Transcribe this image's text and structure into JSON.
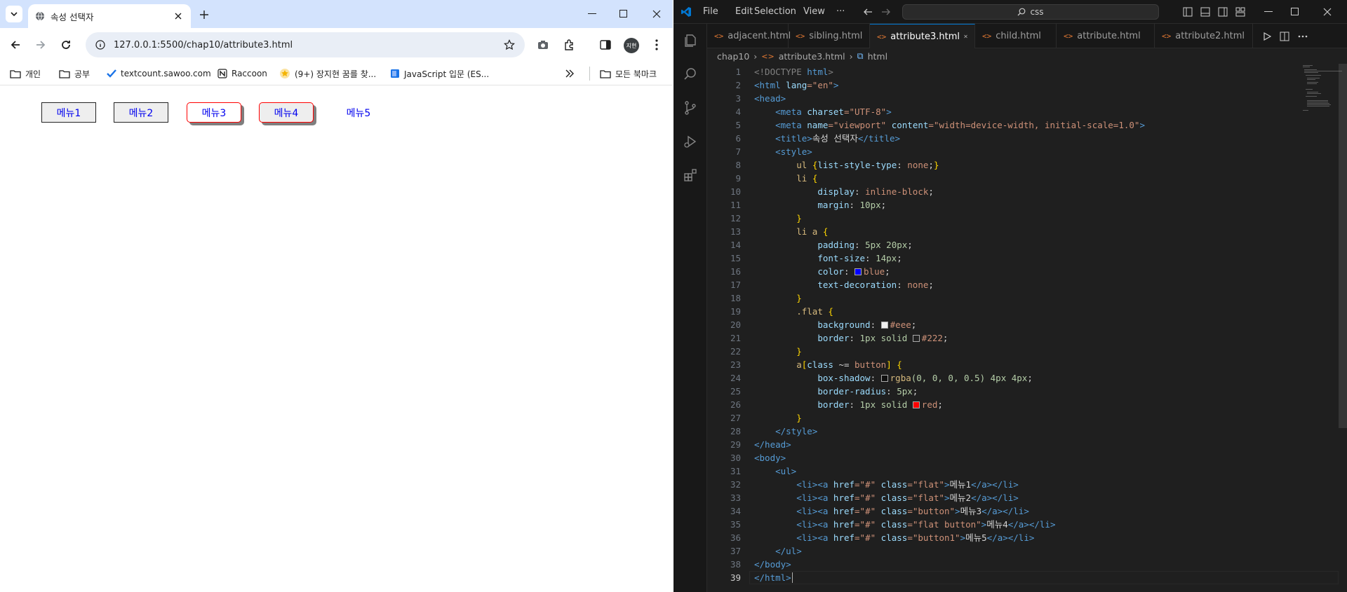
{
  "browser": {
    "tab_title": "속성 선택자",
    "url": "127.0.0.1:5500/chap10/attribute3.html",
    "avatar_text": "지현",
    "bookmarks": [
      "개인",
      "공부",
      "textcount.sawoo.com",
      "Raccoon",
      "(9+) 장지현 꿈를 찾...",
      "JavaScript 입문 (ES...",
      "모든 북마크"
    ],
    "page_menu": [
      "메뉴1",
      "메뉴2",
      "메뉴3",
      "메뉴4",
      "메뉴5"
    ]
  },
  "vscode": {
    "menu": [
      "File",
      "Edit",
      "Selection",
      "View",
      "···"
    ],
    "search_text": "css",
    "tabs": [
      "adjacent.html",
      "sibling.html",
      "attribute3.html",
      "child.html",
      "attribute.html",
      "attribute2.html"
    ],
    "active_tab": "attribute3.html",
    "breadcrumb": [
      "chap10",
      "attribute3.html",
      "html"
    ],
    "line_numbers": [
      "1",
      "2",
      "3",
      "4",
      "5",
      "6",
      "7",
      "8",
      "9",
      "10",
      "11",
      "12",
      "13",
      "14",
      "15",
      "16",
      "17",
      "18",
      "19",
      "20",
      "21",
      "22",
      "23",
      "24",
      "25",
      "26",
      "27",
      "28",
      "29",
      "30",
      "31",
      "32",
      "33",
      "34",
      "35",
      "36",
      "37",
      "38",
      "39"
    ],
    "code": {
      "l1_a": "<!DOCTYPE",
      "l1_b": "html",
      "l1_c": ">",
      "l2_a": "<html",
      "l2_b": "lang",
      "l2_c": "=\"en\"",
      "l2_d": ">",
      "l3": "<head>",
      "l4_a": "<meta",
      "l4_b": "charset",
      "l4_c": "=\"UTF-8\"",
      "l4_d": ">",
      "l5_a": "<meta",
      "l5_b": "name",
      "l5_c": "=\"viewport\"",
      "l5_d": "content",
      "l5_e": "=\"width=device-width, initial-scale=1.0\"",
      "l5_f": ">",
      "l6_a": "<title>",
      "l6_b": "속성 선택자",
      "l6_c": "</title>",
      "l7": "<style>",
      "l8_a": "ul",
      "l8_b": "{",
      "l8_c": "list-style-type",
      "l8_d": ": ",
      "l8_e": "none",
      "l8_f": ";",
      "l8_g": "}",
      "l9_a": "li",
      "l9_b": "{",
      "l10_a": "display",
      "l10_b": "inline-block",
      "l11_a": "margin",
      "l11_b": "10px",
      "l12": "}",
      "l13_a": "li a",
      "l13_b": "{",
      "l14_a": "padding",
      "l14_b": "5px 20px",
      "l15_a": "font-size",
      "l15_b": "14px",
      "l16_a": "color",
      "l16_b": "blue",
      "l17_a": "text-decoration",
      "l17_b": "none",
      "l18": "}",
      "l19_a": ".flat",
      "l19_b": "{",
      "l20_a": "background",
      "l20_b": "#eee",
      "l21_a": "border",
      "l21_b": "1px solid",
      "l21_c": "#222",
      "l22": "}",
      "l23_a": "a",
      "l23_b": "[",
      "l23_c": "class",
      "l23_d": " ~= ",
      "l23_e": "button",
      "l23_f": "]",
      "l23_g": "{",
      "l24_a": "box-shadow",
      "l24_b": "rgba",
      "l24_c": "(0, 0, 0, 0.5)",
      "l24_d": "4px 4px",
      "l25_a": "border-radius",
      "l25_b": "5px",
      "l26_a": "border",
      "l26_b": "1px solid",
      "l26_c": "red",
      "l27": "}",
      "l28": "</style>",
      "l29": "</head>",
      "l30": "<body>",
      "l31": "<ul>",
      "li_open": "<li>",
      "a_open": "<a",
      "href": "href",
      "href_val": "=\"#\"",
      "cls": "class",
      "a_close": "</a>",
      "li_close": "</li>",
      "gt": ">",
      "l32_cls": "=\"flat\"",
      "l32_txt": "메뉴1",
      "l33_cls": "=\"flat\"",
      "l33_txt": "메뉴2",
      "l34_cls": "=\"button\"",
      "l34_txt": "메뉴3",
      "l35_cls": "=\"flat button\"",
      "l35_txt": "메뉴4",
      "l36_cls": "=\"button1\"",
      "l36_txt": "메뉴5",
      "l37": "</ul>",
      "l38": "</body>",
      "l39": "</html>",
      "colon": ": ",
      "semi": ";"
    }
  },
  "colors": {
    "browser_tabstrip": "#d3e3fd",
    "vscode_bg": "#1f1f1f",
    "link_blue": "#0000ee",
    "button_border": "#ff0000"
  }
}
